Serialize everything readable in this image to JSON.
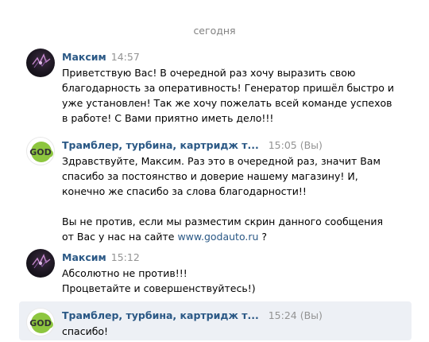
{
  "date_separator": "сегодня",
  "messages": [
    {
      "author": "Максим",
      "time": "14:57",
      "lines": [
        "Приветствую Вас! В очередной раз хочу выразить свою",
        "благодарность за оперативность! Генератор пришёл быстро и",
        "уже установлен! Так же хочу пожелать всей команде успехов",
        "в работе! С Вами приятно иметь дело!!!"
      ]
    },
    {
      "author": "Трамблер, турбина, картридж т...",
      "time": "15:05 (Вы)",
      "lines": [
        "Здравствуйте, Максим. Раз это в очередной раз, значит Вам",
        "спасибо за постоянство и доверие нашему магазину! И,",
        "конечно же спасибо за слова благодарности!!"
      ],
      "para2_line1": "Вы не против, если мы разместим скрин данного сообщения",
      "para2_line2_prefix": "от Вас у нас на сайте ",
      "link": "www.godauto.ru",
      "para2_line2_suffix": " ?"
    },
    {
      "author": "Максим",
      "time": "15:12",
      "lines": [
        "Абсолютно не против!!!",
        "Процветайте и совершенствуйтесь!)"
      ]
    },
    {
      "author": "Трамблер, турбина, картридж т...",
      "time": "15:24 (Вы)",
      "lines": [
        "спасибо!"
      ]
    }
  ],
  "avatar_god_text": "GOD",
  "colors": {
    "author": "#2a5885",
    "time": "#939393",
    "highlight": "#edf0f5",
    "god_green": "#8dc63f"
  }
}
